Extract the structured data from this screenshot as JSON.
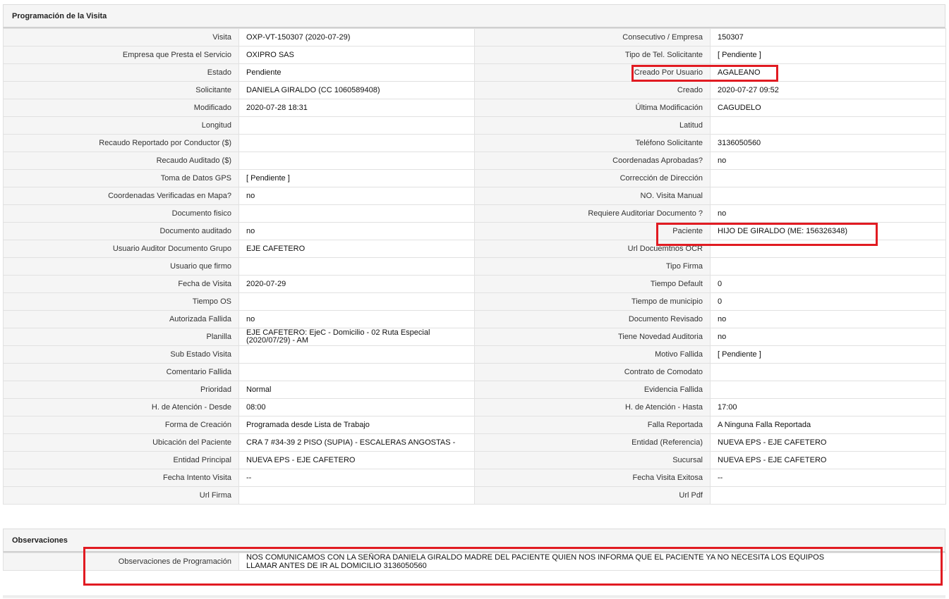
{
  "panel1": {
    "title": "Programación de la Visita",
    "rows": [
      {
        "l1": "Visita",
        "v1": "OXP-VT-150307 (2020-07-29)",
        "l2": "Consecutivo / Empresa",
        "v2": "150307"
      },
      {
        "l1": "Empresa que Presta el Servicio",
        "v1": "OXIPRO SAS",
        "l2": "Tipo de Tel. Solicitante",
        "v2": "[ Pendiente ]"
      },
      {
        "l1": "Estado",
        "v1": "Pendiente",
        "l2": "Creado Por Usuario",
        "v2": "AGALEANO"
      },
      {
        "l1": "Solicitante",
        "v1": "DANIELA GIRALDO (CC 1060589408)",
        "l2": "Creado",
        "v2": "2020-07-27 09:52"
      },
      {
        "l1": "Modificado",
        "v1": "2020-07-28 18:31",
        "l2": "Última Modificación",
        "v2": " CAGUDELO"
      },
      {
        "l1": "Longitud",
        "v1": "",
        "l2": "Latitud",
        "v2": ""
      },
      {
        "l1": "Recaudo Reportado por Conductor ($)",
        "v1": "",
        "l2": "Teléfono Solicitante",
        "v2": "3136050560"
      },
      {
        "l1": "Recaudo Auditado ($)",
        "v1": "",
        "l2": "Coordenadas Aprobadas?",
        "v2": " no"
      },
      {
        "l1": "Toma de Datos GPS",
        "v1": "[ Pendiente ]",
        "l2": "Corrección de Dirección",
        "v2": ""
      },
      {
        "l1": "Coordenadas Verificadas en Mapa?",
        "v1": " no",
        "l2": "NO. Visita Manual",
        "v2": ""
      },
      {
        "l1": "Documento fisico",
        "v1": "",
        "l2": "Requiere Auditoriar Documento ?",
        "v2": " no"
      },
      {
        "l1": "Documento auditado",
        "v1": " no",
        "l2": "Paciente",
        "v2": "HIJO DE GIRALDO (ME: 156326348)"
      },
      {
        "l1": "Usuario Auditor Documento Grupo",
        "v1": "EJE CAFETERO",
        "l2": "Url Docuemtnos OCR",
        "v2": ""
      },
      {
        "l1": "Usuario que firmo",
        "v1": "",
        "l2": "Tipo Firma",
        "v2": ""
      },
      {
        "l1": "Fecha de Visita",
        "v1": " 2020-07-29",
        "l2": "Tiempo Default",
        "v2": "0"
      },
      {
        "l1": "Tiempo OS",
        "v1": "",
        "l2": "Tiempo de municipio",
        "v2": "0"
      },
      {
        "l1": "Autorizada Fallida",
        "v1": " no",
        "l2": "Documento Revisado",
        "v2": " no"
      },
      {
        "l1": "Planilla",
        "v1": "EJE CAFETERO: EjeC - Domicilio - 02 Ruta Especial (2020/07/29) - AM",
        "l2": "Tiene Novedad Auditoria",
        "v2": " no"
      },
      {
        "l1": "Sub Estado Visita",
        "v1": "",
        "l2": "Motivo Fallida",
        "v2": "[ Pendiente ]"
      },
      {
        "l1": "Comentario Fallida",
        "v1": "",
        "l2": "Contrato de Comodato",
        "v2": ""
      },
      {
        "l1": "Prioridad",
        "v1": "Normal",
        "l2": "Evidencia Fallida",
        "v2": ""
      },
      {
        "l1": "H. de Atención - Desde",
        "v1": "08:00",
        "l2": "H. de Atención - Hasta",
        "v2": "17:00"
      },
      {
        "l1": "Forma de Creación",
        "v1": "Programada desde Lista de Trabajo",
        "l2": "Falla Reportada",
        "v2": "A Ninguna Falla Reportada"
      },
      {
        "l1": "Ubicación del Paciente",
        "v1": "CRA 7 #34-39 2 PISO (SUPIA) - ESCALERAS ANGOSTAS -",
        "l2": "Entidad (Referencia)",
        "v2": "NUEVA EPS - EJE CAFETERO"
      },
      {
        "l1": "Entidad Principal",
        "v1": "NUEVA EPS - EJE CAFETERO",
        "l2": "Sucursal",
        "v2": "NUEVA EPS - EJE CAFETERO"
      },
      {
        "l1": "Fecha Intento Visita",
        "v1": " --",
        "l2": "Fecha Visita Exitosa",
        "v2": " --"
      },
      {
        "l1": "Url Firma",
        "v1": "",
        "l2": "Url Pdf",
        "v2": ""
      }
    ]
  },
  "panel2": {
    "title": "Observaciones",
    "label": "Observaciones de Programación",
    "text": " NOS COMUNICAMOS CON LA SEÑORA DANIELA GIRALDO MADRE DEL PACIENTE QUIEN NOS INFORMA QUE EL PACIENTE YA NO NECESITA LOS EQUIPOS\nLLAMAR ANTES DE IR AL DOMICILIO 3136050560"
  },
  "colors": {
    "highlight": "#e11b22",
    "label_bg": "#f5f5f5",
    "border": "#e1e1e1"
  }
}
